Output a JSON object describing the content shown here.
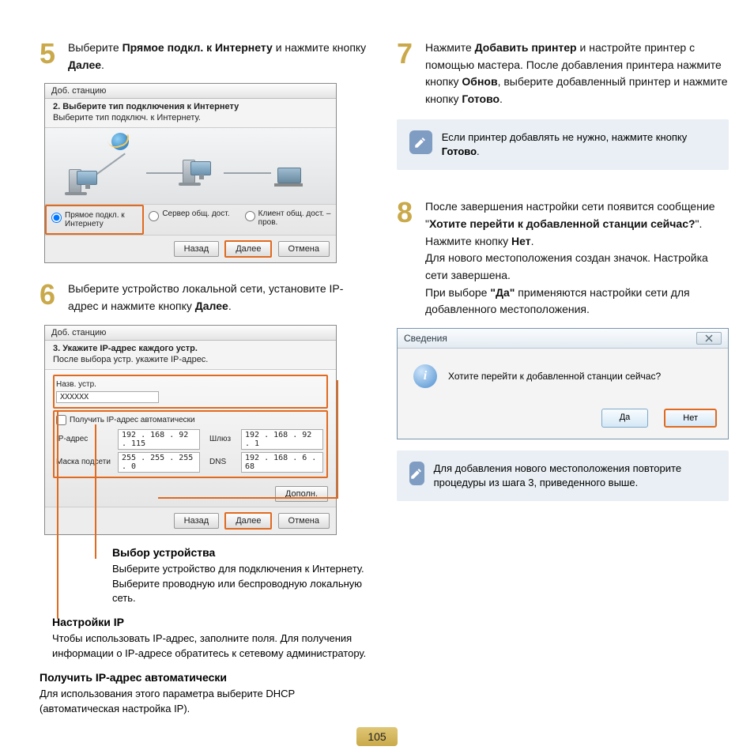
{
  "steps": {
    "s5": {
      "num": "5",
      "pre": "Выберите ",
      "b1": "Прямое подкл. к Интернету",
      "mid": " и нажмите кнопку ",
      "b2": "Далее",
      "post": "."
    },
    "s6": {
      "num": "6",
      "text_a": "Выберите устройство локальной сети, установите IP-адрес и нажмите кнопку ",
      "b1": "Далее",
      "post": "."
    },
    "s7": {
      "num": "7",
      "a": "Нажмите ",
      "b1": "Добавить принтер",
      "b": " и настройте принтер с помощью мастера. После добавления принтера нажмите кнопку ",
      "b2": "Обнов",
      "c": ", выберите добавленный принтер и нажмите кнопку ",
      "b3": "Готово",
      "post": "."
    },
    "s8": {
      "num": "8",
      "a": "После завершения настройки сети появится сообщение \"",
      "b1": "Хотите перейти к добавленной станции сейчас?",
      "b": "\". Нажмите кнопку ",
      "b2": "Нет",
      "c": ".",
      "d": "Для нового местоположения создан значок. Настройка сети завершена.",
      "e1": "При выборе ",
      "b3": "\"Да\"",
      "e2": " применяются настройки сети для добавленного местоположения."
    }
  },
  "wiz1": {
    "title": "Доб. станцию",
    "sub": "2. Выберите тип подключения к Интернету",
    "sub2": "Выберите тип подключ. к Интернету.",
    "opt1": "Прямое подкл. к Интернету",
    "opt2": "Сервер общ. дост.",
    "opt3": "Клиент общ. дост. – пров.",
    "back": "Назад",
    "next": "Далее",
    "cancel": "Отмена"
  },
  "wiz2": {
    "title": "Доб. станцию",
    "sub": "3. Укажите IP-адрес каждого устр.",
    "sub2": "После выбора устр. укажите IP-адрес.",
    "namelabel": "Назв. устр.",
    "nameval": "XXXXXX",
    "auto": "Получить IP-адрес автоматически",
    "ip_l": "IP-адрес",
    "ip_v": "192 . 168 . 92 . 115",
    "gw_l": "Шлюз",
    "gw_v": "192 . 168 . 92 .   1",
    "mask_l": "Маска подсети",
    "mask_v": "255 . 255 . 255 .   0",
    "dns_l": "DNS",
    "dns_v": "192 . 168 .  6 .  68",
    "advbtn": "Дополн.",
    "back": "Назад",
    "next": "Далее",
    "cancel": "Отмена"
  },
  "callouts": {
    "dev_h": "Выбор устройства",
    "dev_t": "Выберите устройство для подключения к Интернету. Выберите проводную или беспроводную локальную сеть.",
    "ip_h": "Настройки IP",
    "ip_t": "Чтобы использовать IP-адрес, заполните поля. Для получения информации о IP-адресе обратитесь к сетевому администратору.",
    "auto_h": "Получить IP-адрес автоматически",
    "auto_t": "Для использования этого параметра выберите DHCP (автоматическая настройка IP)."
  },
  "note1": {
    "a": "Если принтер добавлять не нужно, нажмите кнопку ",
    "b": "Готово",
    "c": "."
  },
  "note2": {
    "text": "Для добавления нового местоположения повторите процедуры из шага 3, приведенного выше."
  },
  "info": {
    "title": "Сведения",
    "msg": "Хотите перейти к добавленной станции сейчас?",
    "yes": "Да",
    "no": "Нет"
  },
  "pagenum": "105"
}
